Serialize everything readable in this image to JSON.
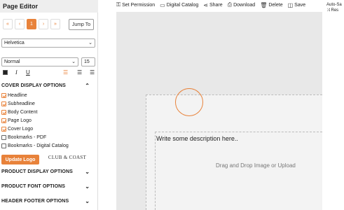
{
  "sidebar": {
    "title": "Page Editor",
    "pager": {
      "first": "«",
      "prev": "‹",
      "current": "1",
      "next": "›",
      "last": "»",
      "jump": "Jump To"
    },
    "font": "Helvetica",
    "weight": "Normal",
    "size": "15",
    "cover_section": "COVER DISPLAY OPTIONS",
    "options": [
      {
        "label": "Headline",
        "checked": true
      },
      {
        "label": "Subheadline",
        "checked": true
      },
      {
        "label": "Body Content",
        "checked": true
      },
      {
        "label": "Page Logo",
        "checked": true
      },
      {
        "label": "Cover Logo",
        "checked": true
      },
      {
        "label": "Bookmarks - PDF",
        "checked": false
      },
      {
        "label": "Bookmarks - Digital Catalog",
        "checked": false
      }
    ],
    "update_logo": "Update Logo",
    "logo_text": "CLUB & COAST",
    "sections": {
      "product_display": "PRODUCT DISPLAY OPTIONS",
      "product_font": "PRODUCT FONT OPTIONS",
      "header_footer": "HEADER FOOTER OPTIONS"
    },
    "accent": "#e8823a"
  },
  "toolbar": {
    "set_permission": "Set Permission",
    "digital_catalog": "Digital Catalog",
    "share": "Share",
    "download": "Download",
    "delete": "Delete",
    "save": "Save",
    "auto_save": "Auto-Sa",
    "auto_save_sub": "Res"
  },
  "canvas": {
    "description_placeholder": "Write some description here..",
    "upload_hint": "Drag and Drop Image or Upload"
  }
}
